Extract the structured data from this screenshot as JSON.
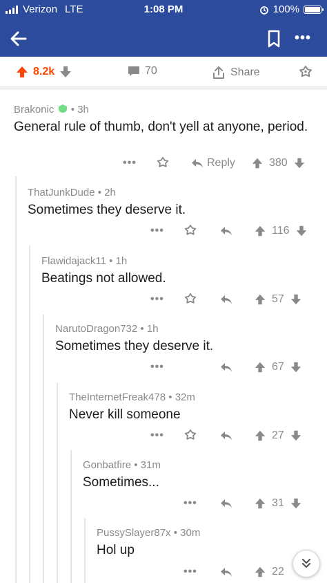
{
  "status": {
    "carrier": "Verizon",
    "network": "LTE",
    "time": "1:08 PM",
    "battery": "100%"
  },
  "post_actions": {
    "score": "8.2k",
    "comments": "70",
    "share": "Share"
  },
  "comments": [
    {
      "author": "Brakonic",
      "time": "3h",
      "body": "General rule of thumb, don't yell at anyone, period.",
      "score": "380",
      "reply": "Reply"
    },
    {
      "author": "ThatJunkDude",
      "time": "2h",
      "body": "Sometimes they deserve it.",
      "score": "116"
    },
    {
      "author": "Flawidajack11",
      "time": "1h",
      "body": "Beatings not allowed.",
      "score": "57"
    },
    {
      "author": "NarutoDragon732",
      "time": "1h",
      "body": "Sometimes they deserve it.",
      "score": "67"
    },
    {
      "author": "TheInternetFreak478",
      "time": "32m",
      "body": "Never kill someone",
      "score": "27"
    },
    {
      "author": "Gonbatfire",
      "time": "31m",
      "body": "Sometimes...",
      "score": "31"
    },
    {
      "author": "PussySlayer87x",
      "time": "30m",
      "body": "Hol up",
      "score": "22"
    }
  ],
  "icons": {
    "back": "arrow-left-icon",
    "bookmark": "bookmark-icon",
    "more": "more-horizontal-icon",
    "upvote": "arrow-up-icon",
    "downvote": "arrow-down-icon",
    "comment": "comment-bubble-icon",
    "share": "share-icon",
    "award": "award-icon",
    "reply": "reply-icon",
    "mod": "moderator-shield-icon",
    "jump": "double-chevron-down-icon"
  },
  "colors": {
    "nav": "#2d4b9c",
    "upvoted": "#ff4500",
    "mod": "#46d160",
    "muted": "#8a8a8a"
  }
}
